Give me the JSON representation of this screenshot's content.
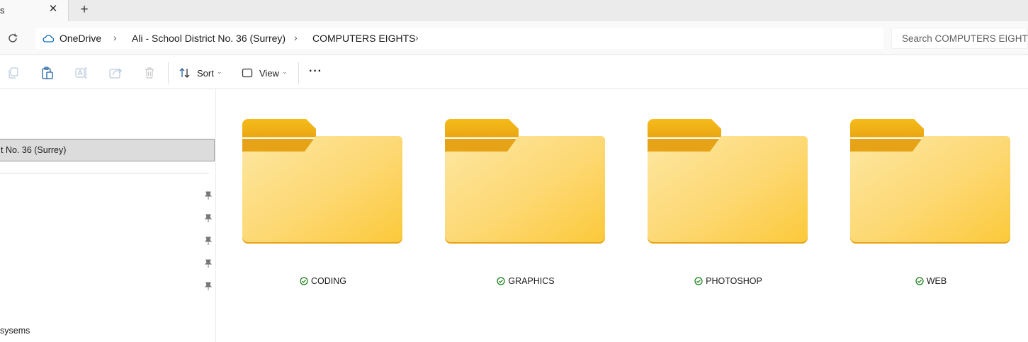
{
  "tab": {
    "title": "s",
    "close_icon": "close-icon",
    "new_tab_icon": "plus-icon"
  },
  "address": {
    "breadcrumbs": [
      "OneDrive",
      "Ali - School District No. 36 (Surrey)",
      "COMPUTERS EIGHTS"
    ],
    "cloud_color": "#0f6cbd"
  },
  "search": {
    "placeholder": "Search COMPUTERS EIGHTS"
  },
  "toolbar": {
    "sort_label": "Sort",
    "view_label": "View",
    "more_label": "···"
  },
  "nav": {
    "selected_label": "t No. 36 (Surrey)",
    "pinned_count": 5,
    "bottom_label": "sysems"
  },
  "folders": [
    {
      "name": "CODING"
    },
    {
      "name": "GRAPHICS"
    },
    {
      "name": "PHOTOSHOP"
    },
    {
      "name": "WEB"
    }
  ],
  "colors": {
    "folder_back": "#f2b415",
    "folder_front_light": "#fde7a2",
    "folder_front_dark": "#fcc93a",
    "synced_green": "#107c10"
  }
}
